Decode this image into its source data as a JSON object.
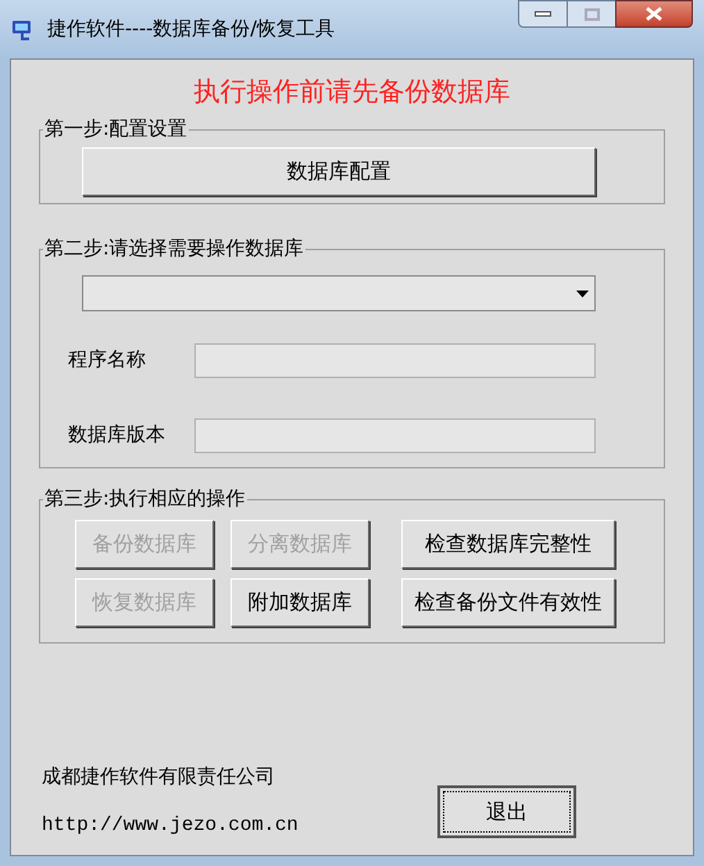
{
  "window": {
    "title": "捷作软件----数据库备份/恢复工具"
  },
  "notice": "执行操作前请先备份数据库",
  "step1": {
    "legend": "第一步:配置设置",
    "button": "数据库配置"
  },
  "step2": {
    "legend": "第二步:请选择需要操作数据库",
    "fields": [
      {
        "label": "程序名称"
      },
      {
        "label": "数据库版本"
      }
    ]
  },
  "step3": {
    "legend": "第三步:执行相应的操作",
    "buttons": [
      {
        "label": "备份数据库",
        "disabled": true
      },
      {
        "label": "分离数据库",
        "disabled": true
      },
      {
        "label": "检查数据库完整性",
        "disabled": false
      },
      {
        "label": "恢复数据库",
        "disabled": true
      },
      {
        "label": "附加数据库",
        "disabled": false
      },
      {
        "label": "检查备份文件有效性",
        "disabled": false
      }
    ]
  },
  "footer": {
    "company": "成都捷作软件有限责任公司",
    "url": "http://www.jezo.com.cn",
    "exit_button": {
      "label": "退出",
      "focused": true
    }
  }
}
